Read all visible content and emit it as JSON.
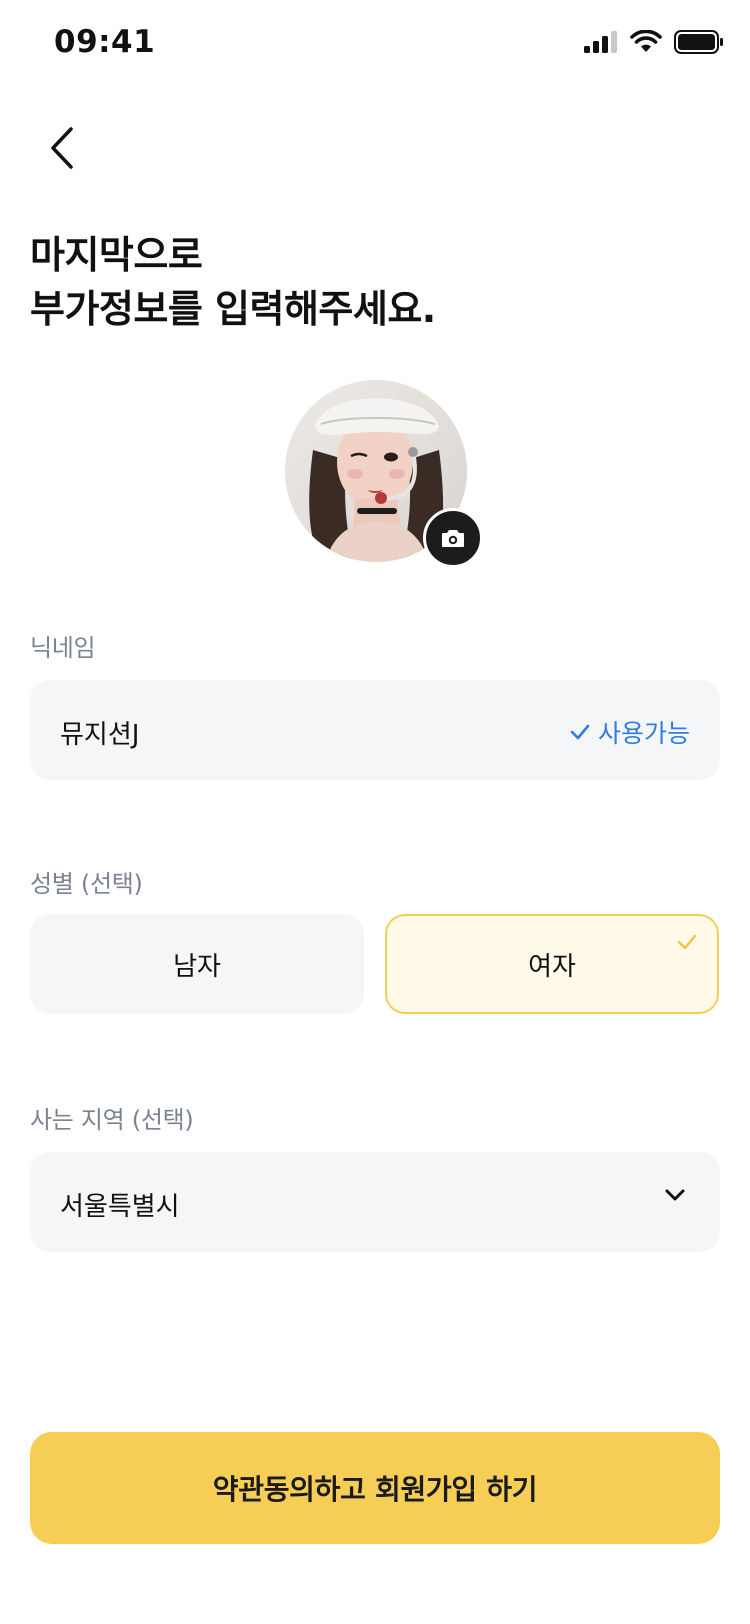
{
  "status_bar": {
    "time": "09:41"
  },
  "header": {
    "title_line1": "마지막으로",
    "title_line2": "부가정보를 입력해주세요."
  },
  "nickname": {
    "label": "닉네임",
    "value": "뮤지션J",
    "status": "사용가능"
  },
  "gender": {
    "label": "성별 (선택)",
    "options": [
      "남자",
      "여자"
    ],
    "selected": "여자"
  },
  "region": {
    "label": "사는 지역 (선택)",
    "value": "서울특별시"
  },
  "cta": {
    "label": "약관동의하고 회원가입 하기"
  },
  "colors": {
    "accent": "#f6cd55",
    "available": "#2f7ddf",
    "field_bg": "#f5f6f8",
    "selected_bg": "#fff9e9"
  }
}
